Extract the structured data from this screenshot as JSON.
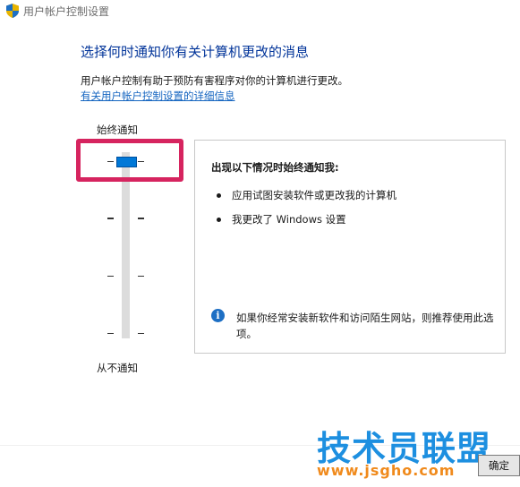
{
  "window": {
    "title": "用户帐户控制设置"
  },
  "main": {
    "heading": "选择何时通知你有关计算机更改的消息",
    "description": "用户帐户控制有助于预防有害程序对你的计算机进行更改。",
    "link_text": "有关用户帐户控制设置的详细信息"
  },
  "slider": {
    "top_label": "始终通知",
    "bottom_label": "从不通知",
    "levels": 4,
    "selected_level": 4
  },
  "panel": {
    "title": "出现以下情况时始终通知我:",
    "bullets": [
      "应用试图安装软件或更改我的计算机",
      "我更改了 Windows 设置"
    ],
    "info_text": "如果你经常安装新软件和访问陌生网站，则推荐使用此选项。"
  },
  "buttons": {
    "ok_label": "确定"
  },
  "watermark": {
    "brand": "技术员联盟",
    "url": "www.jsgho.com"
  },
  "colors": {
    "accent": "#0078d7",
    "heading": "#003399",
    "highlight": "#d6245f"
  }
}
